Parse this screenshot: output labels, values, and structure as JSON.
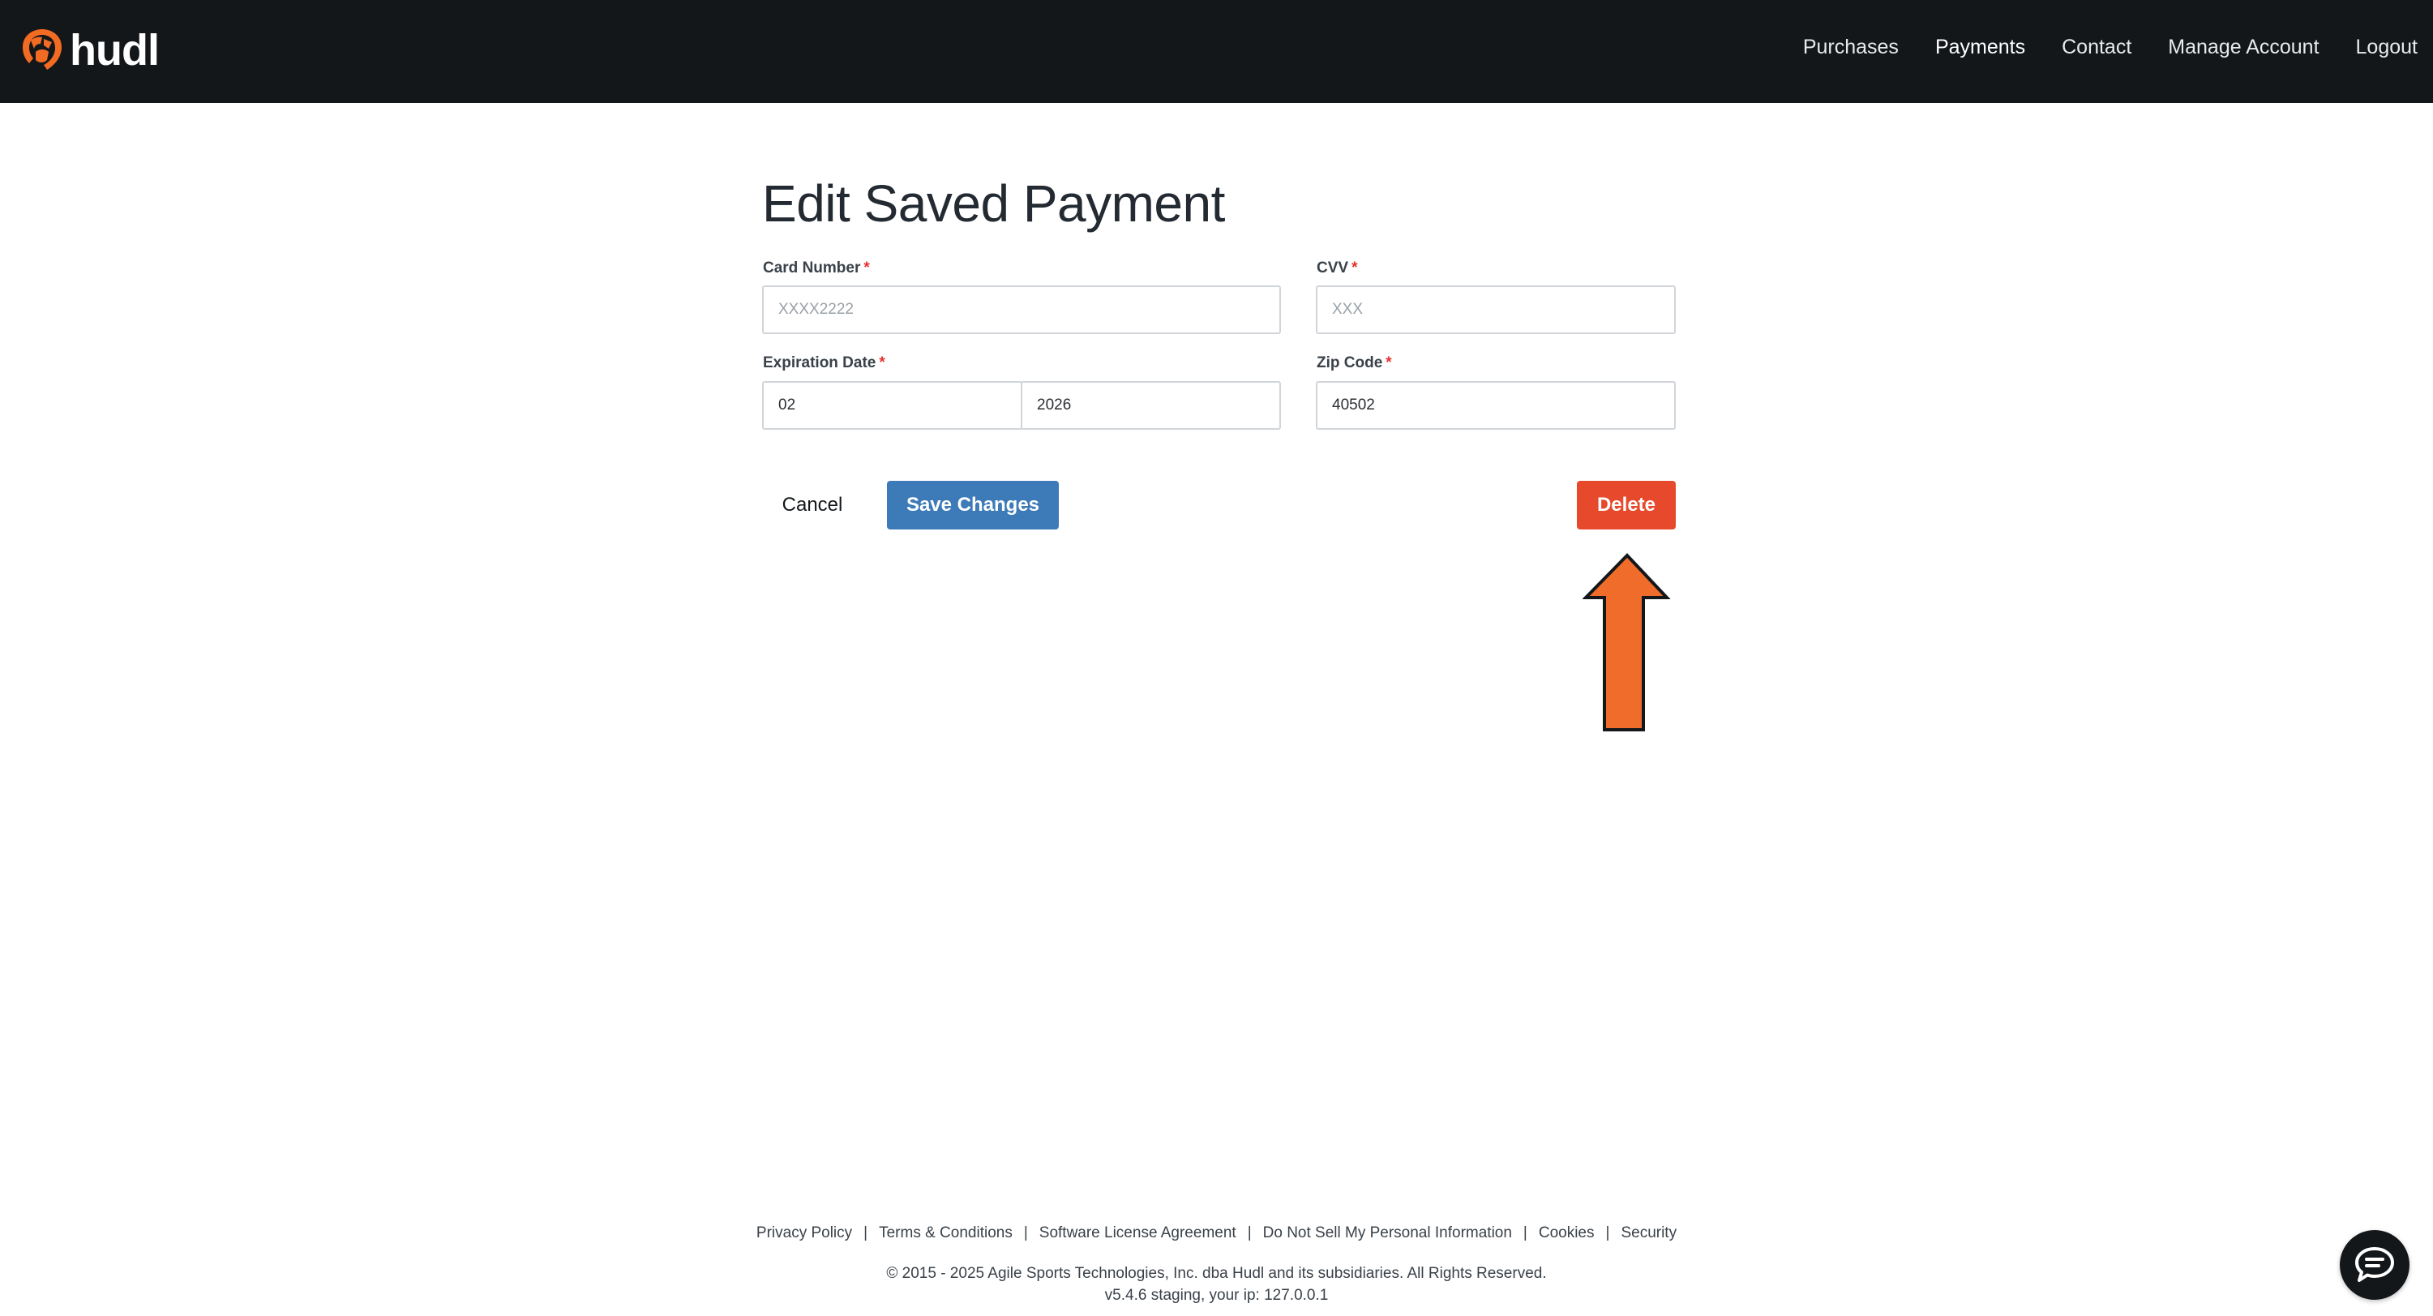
{
  "brand": {
    "name": "hudl",
    "accent": "#f26b23"
  },
  "nav": {
    "items": [
      {
        "label": "Purchases"
      },
      {
        "label": "Payments"
      },
      {
        "label": "Contact"
      },
      {
        "label": "Manage Account"
      },
      {
        "label": "Logout"
      }
    ],
    "active": "Payments"
  },
  "form": {
    "title": "Edit Saved Payment",
    "card_number": {
      "label": "Card Number",
      "required": "*",
      "placeholder": "XXXX2222",
      "value": ""
    },
    "cvv": {
      "label": "CVV",
      "required": "*",
      "placeholder": "XXX",
      "value": ""
    },
    "expiration": {
      "label": "Expiration Date",
      "required": "*",
      "month": "02",
      "year": "2026"
    },
    "zip": {
      "label": "Zip Code",
      "required": "*",
      "value": "40502"
    }
  },
  "actions": {
    "cancel": "Cancel",
    "save": "Save Changes",
    "delete": "Delete"
  },
  "annotation": {
    "arrow_color": "#ef6c2a",
    "points_to": "delete-button"
  },
  "footer": {
    "links": [
      "Privacy Policy",
      "Terms & Conditions",
      "Software License Agreement",
      "Do Not Sell My Personal Information",
      "Cookies",
      "Security"
    ],
    "separator": "|",
    "copyright": "© 2015 - 2025 Agile Sports Technologies, Inc. dba Hudl and its subsidiaries. All Rights Reserved.",
    "version": "v5.4.6 staging, your ip: 127.0.0.1"
  },
  "colors": {
    "topbar": "#14171a",
    "save_button": "#3d7ab8",
    "delete_button": "#e6492b",
    "required": "#e8312b"
  }
}
